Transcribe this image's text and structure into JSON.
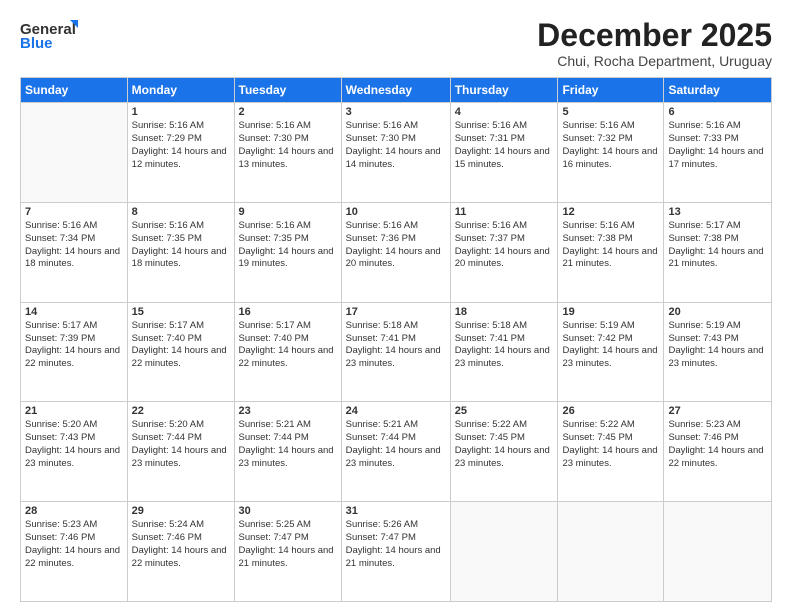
{
  "logo": {
    "line1": "General",
    "line2": "Blue"
  },
  "header": {
    "month": "December 2025",
    "location": "Chui, Rocha Department, Uruguay"
  },
  "weekdays": [
    "Sunday",
    "Monday",
    "Tuesday",
    "Wednesday",
    "Thursday",
    "Friday",
    "Saturday"
  ],
  "weeks": [
    [
      {
        "day": "",
        "text": ""
      },
      {
        "day": "1",
        "text": "Sunrise: 5:16 AM\nSunset: 7:29 PM\nDaylight: 14 hours\nand 12 minutes."
      },
      {
        "day": "2",
        "text": "Sunrise: 5:16 AM\nSunset: 7:30 PM\nDaylight: 14 hours\nand 13 minutes."
      },
      {
        "day": "3",
        "text": "Sunrise: 5:16 AM\nSunset: 7:30 PM\nDaylight: 14 hours\nand 14 minutes."
      },
      {
        "day": "4",
        "text": "Sunrise: 5:16 AM\nSunset: 7:31 PM\nDaylight: 14 hours\nand 15 minutes."
      },
      {
        "day": "5",
        "text": "Sunrise: 5:16 AM\nSunset: 7:32 PM\nDaylight: 14 hours\nand 16 minutes."
      },
      {
        "day": "6",
        "text": "Sunrise: 5:16 AM\nSunset: 7:33 PM\nDaylight: 14 hours\nand 17 minutes."
      }
    ],
    [
      {
        "day": "7",
        "text": "Sunrise: 5:16 AM\nSunset: 7:34 PM\nDaylight: 14 hours\nand 18 minutes."
      },
      {
        "day": "8",
        "text": "Sunrise: 5:16 AM\nSunset: 7:35 PM\nDaylight: 14 hours\nand 18 minutes."
      },
      {
        "day": "9",
        "text": "Sunrise: 5:16 AM\nSunset: 7:35 PM\nDaylight: 14 hours\nand 19 minutes."
      },
      {
        "day": "10",
        "text": "Sunrise: 5:16 AM\nSunset: 7:36 PM\nDaylight: 14 hours\nand 20 minutes."
      },
      {
        "day": "11",
        "text": "Sunrise: 5:16 AM\nSunset: 7:37 PM\nDaylight: 14 hours\nand 20 minutes."
      },
      {
        "day": "12",
        "text": "Sunrise: 5:16 AM\nSunset: 7:38 PM\nDaylight: 14 hours\nand 21 minutes."
      },
      {
        "day": "13",
        "text": "Sunrise: 5:17 AM\nSunset: 7:38 PM\nDaylight: 14 hours\nand 21 minutes."
      }
    ],
    [
      {
        "day": "14",
        "text": "Sunrise: 5:17 AM\nSunset: 7:39 PM\nDaylight: 14 hours\nand 22 minutes."
      },
      {
        "day": "15",
        "text": "Sunrise: 5:17 AM\nSunset: 7:40 PM\nDaylight: 14 hours\nand 22 minutes."
      },
      {
        "day": "16",
        "text": "Sunrise: 5:17 AM\nSunset: 7:40 PM\nDaylight: 14 hours\nand 22 minutes."
      },
      {
        "day": "17",
        "text": "Sunrise: 5:18 AM\nSunset: 7:41 PM\nDaylight: 14 hours\nand 23 minutes."
      },
      {
        "day": "18",
        "text": "Sunrise: 5:18 AM\nSunset: 7:41 PM\nDaylight: 14 hours\nand 23 minutes."
      },
      {
        "day": "19",
        "text": "Sunrise: 5:19 AM\nSunset: 7:42 PM\nDaylight: 14 hours\nand 23 minutes."
      },
      {
        "day": "20",
        "text": "Sunrise: 5:19 AM\nSunset: 7:43 PM\nDaylight: 14 hours\nand 23 minutes."
      }
    ],
    [
      {
        "day": "21",
        "text": "Sunrise: 5:20 AM\nSunset: 7:43 PM\nDaylight: 14 hours\nand 23 minutes."
      },
      {
        "day": "22",
        "text": "Sunrise: 5:20 AM\nSunset: 7:44 PM\nDaylight: 14 hours\nand 23 minutes."
      },
      {
        "day": "23",
        "text": "Sunrise: 5:21 AM\nSunset: 7:44 PM\nDaylight: 14 hours\nand 23 minutes."
      },
      {
        "day": "24",
        "text": "Sunrise: 5:21 AM\nSunset: 7:44 PM\nDaylight: 14 hours\nand 23 minutes."
      },
      {
        "day": "25",
        "text": "Sunrise: 5:22 AM\nSunset: 7:45 PM\nDaylight: 14 hours\nand 23 minutes."
      },
      {
        "day": "26",
        "text": "Sunrise: 5:22 AM\nSunset: 7:45 PM\nDaylight: 14 hours\nand 23 minutes."
      },
      {
        "day": "27",
        "text": "Sunrise: 5:23 AM\nSunset: 7:46 PM\nDaylight: 14 hours\nand 22 minutes."
      }
    ],
    [
      {
        "day": "28",
        "text": "Sunrise: 5:23 AM\nSunset: 7:46 PM\nDaylight: 14 hours\nand 22 minutes."
      },
      {
        "day": "29",
        "text": "Sunrise: 5:24 AM\nSunset: 7:46 PM\nDaylight: 14 hours\nand 22 minutes."
      },
      {
        "day": "30",
        "text": "Sunrise: 5:25 AM\nSunset: 7:47 PM\nDaylight: 14 hours\nand 21 minutes."
      },
      {
        "day": "31",
        "text": "Sunrise: 5:26 AM\nSunset: 7:47 PM\nDaylight: 14 hours\nand 21 minutes."
      },
      {
        "day": "",
        "text": ""
      },
      {
        "day": "",
        "text": ""
      },
      {
        "day": "",
        "text": ""
      }
    ]
  ]
}
